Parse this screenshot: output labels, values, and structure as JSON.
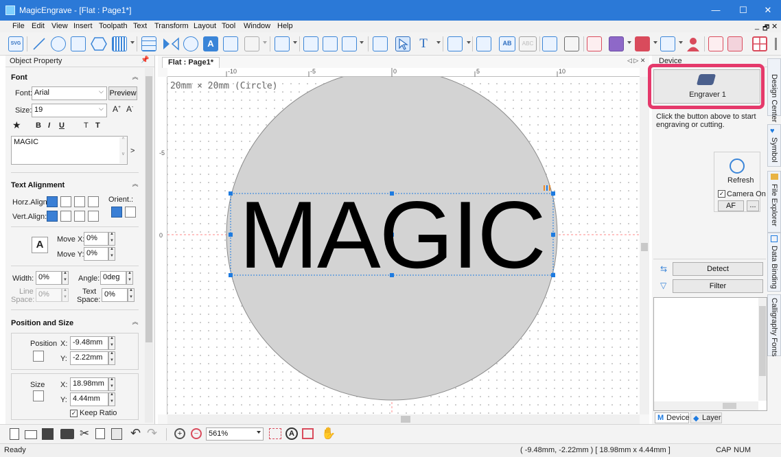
{
  "window": {
    "title": "MagicEngrave - [Flat : Page1*]",
    "minimize": "—",
    "maximize": "☐",
    "close": "✕"
  },
  "menu": [
    "File",
    "Edit",
    "View",
    "Insert",
    "Toolpath",
    "Text",
    "Transform",
    "Layout",
    "Tool",
    "Window",
    "Help"
  ],
  "menu_right": {
    "min": "_",
    "restore": "🗗",
    "close": "✕"
  },
  "toolbar": {
    "svg_label": "SVG",
    "ab_label": "AB",
    "abc_label": "ABC"
  },
  "left_panel": {
    "title": "Object Property",
    "font": {
      "section": "Font",
      "font_label": "Font:",
      "font_value": "Arial",
      "preview": "Preview",
      "size_label": "Size:",
      "size_value": "19",
      "bold": "B",
      "italic": "I",
      "underline": "U",
      "t1": "T",
      "t2": "T",
      "text_value": "MAGIC"
    },
    "alignment": {
      "section": "Text Alignment",
      "horz": "Horz.Align:",
      "vert": "Vert.Align:",
      "orient": "Orient.:",
      "move_x_label": "Move X:",
      "move_x": "0%",
      "move_y_label": "Move Y:",
      "move_y": "0%",
      "width_label": "Width:",
      "width": "0%",
      "angle_label": "Angle:",
      "angle": "0deg",
      "line_label_1": "Line",
      "line_label_2": "Space:",
      "line_space": "0%",
      "text_label_1": "Text",
      "text_label_2": "Space:",
      "text_space": "0%"
    },
    "position_size": {
      "section": "Position and Size",
      "position_label": "Position",
      "px_label": "X:",
      "px": "-9.48mm",
      "py_label": "Y:",
      "py": "-2.22mm",
      "size_label": "Size",
      "sx_label": "X:",
      "sx": "18.98mm",
      "sy_label": "Y:",
      "sy": "4.44mm",
      "keep_ratio": "Keep Ratio"
    }
  },
  "document": {
    "tab": "Flat : Page1*",
    "canvas_note": "20mm × 20mm (Circle)",
    "text_object": "MAGIC",
    "ruler_h": [
      "-10",
      "-5",
      "0",
      "5",
      "10"
    ],
    "ruler_v": [
      "0",
      "-5"
    ],
    "colors": {
      "circle_fill": "#d3d3d3",
      "selection": "#1e7be0",
      "guide": "#ff6a6a"
    }
  },
  "right_panel": {
    "title": "Device",
    "engraver_label": "Engraver 1",
    "hint": "Click the button above to start engraving or cutting.",
    "refresh": "Refresh",
    "camera_on": "Camera On",
    "af": "AF",
    "more": "...",
    "detect": "Detect",
    "filter": "Filter",
    "tab_device": "Device",
    "tab_layer": "Layer",
    "highlight_color": "#e5396b"
  },
  "side_tabs": [
    "Design Center",
    "Symbol",
    "File Explorer",
    "Data Binding",
    "Calligraphy Fonts"
  ],
  "bottom": {
    "zoom": "561%"
  },
  "status": {
    "left": "Ready",
    "coords": "( -9.48mm, -2.22mm )  [ 18.98mm x 4.44mm ]",
    "cap": "CAP",
    "num": "NUM"
  }
}
